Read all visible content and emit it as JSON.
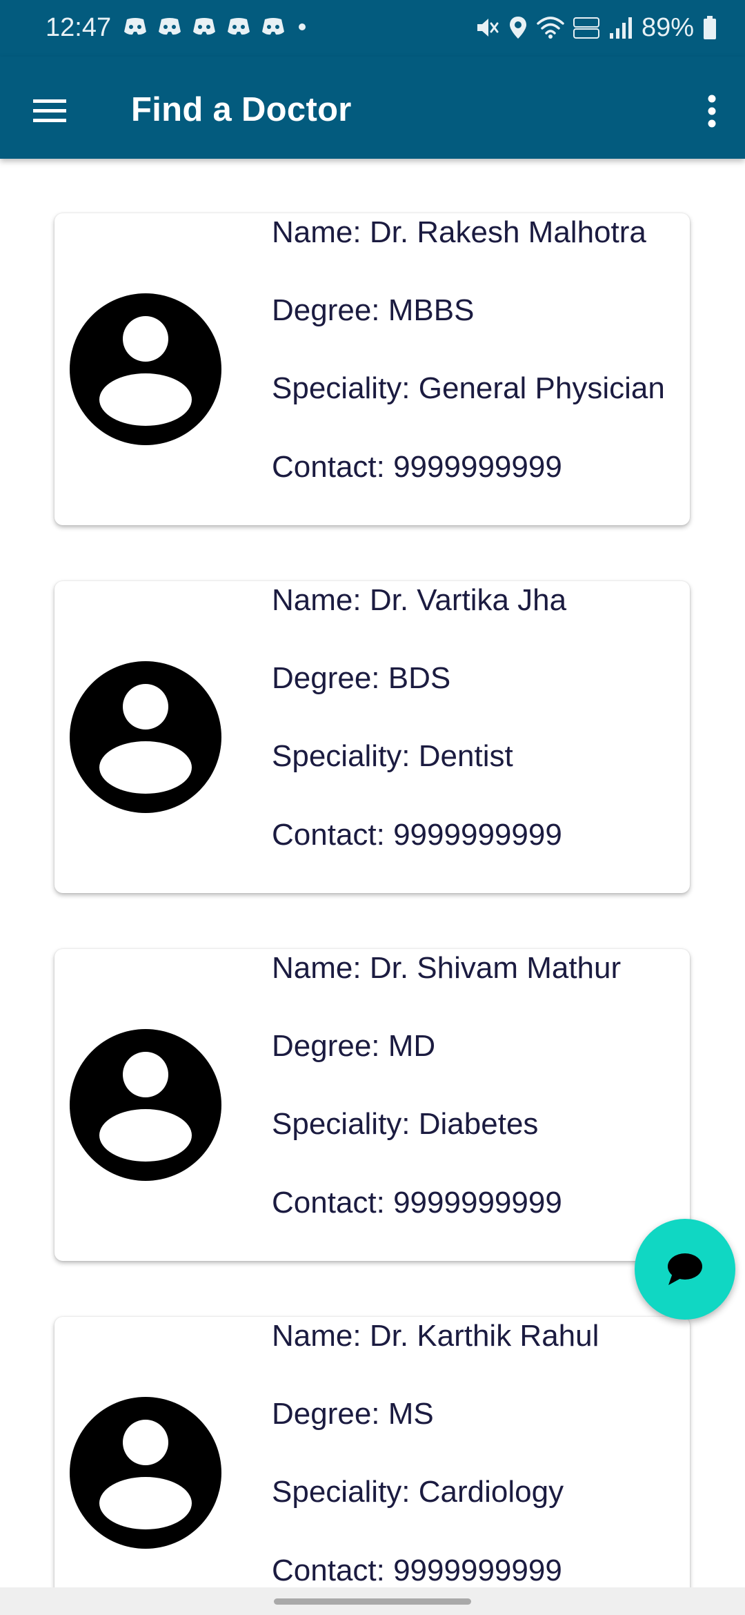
{
  "status_bar": {
    "time": "12:47",
    "battery": "89%",
    "icons": [
      "discord-icon",
      "discord-icon",
      "discord-icon",
      "discord-icon",
      "discord-icon",
      "dot-icon",
      "mute-icon",
      "location-icon",
      "wifi-icon",
      "volte-icon",
      "signal-icon",
      "battery-icon"
    ]
  },
  "toolbar": {
    "title": "Find a Doctor",
    "menu_icon": "hamburger-menu-icon",
    "overflow_icon": "more-vert-icon",
    "color": "#035b7e"
  },
  "doctors": [
    {
      "name": "Name: Dr. Rakesh Malhotra",
      "degree": "Degree: MBBS",
      "speciality": "Speciality: General Physician",
      "contact": "Contact: 9999999999"
    },
    {
      "name": "Name: Dr. Vartika Jha",
      "degree": "Degree: BDS",
      "speciality": "Speciality: Dentist",
      "contact": "Contact: 9999999999"
    },
    {
      "name": "Name: Dr. Shivam Mathur",
      "degree": "Degree: MD",
      "speciality": "Speciality: Diabetes",
      "contact": "Contact: 9999999999"
    },
    {
      "name": "Name: Dr. Karthik Rahul",
      "degree": "Degree: MS",
      "speciality": "Speciality: Cardiology",
      "contact": "Contact: 9999999999"
    }
  ],
  "chat_fab": {
    "icon": "chat-bubble-icon",
    "color": "#10d7c3"
  }
}
